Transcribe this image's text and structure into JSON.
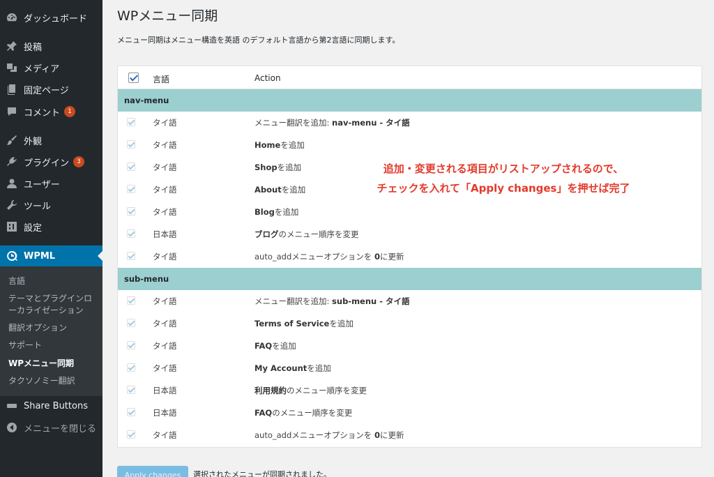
{
  "sidebar": {
    "items": [
      {
        "label": "ダッシュボード",
        "icon": "dashboard-icon"
      },
      {
        "label": "投稿",
        "icon": "pin-icon"
      },
      {
        "label": "メディア",
        "icon": "media-icon"
      },
      {
        "label": "固定ページ",
        "icon": "page-icon"
      },
      {
        "label": "コメント",
        "icon": "comment-icon",
        "badge": "1"
      },
      {
        "label": "外観",
        "icon": "appearance-icon"
      },
      {
        "label": "プラグイン",
        "icon": "plugin-icon",
        "badge": "3"
      },
      {
        "label": "ユーザー",
        "icon": "user-icon"
      },
      {
        "label": "ツール",
        "icon": "wrench-icon"
      },
      {
        "label": "設定",
        "icon": "settings-icon"
      }
    ],
    "wpml": {
      "label": "WPML",
      "icon": "wpml-icon"
    },
    "submenu": [
      "言語",
      "テーマとプラグインロ",
      "ーカライゼーション",
      "翻訳オプション",
      "サポート",
      "WPメニュー同期",
      "タクソノミー翻訳"
    ],
    "share_buttons": "Share Buttons",
    "collapse": "メニューを閉じる"
  },
  "page": {
    "title": "WPメニュー同期",
    "description": "メニュー同期はメニュー構造を英語 のデフォルト言語から第2言語に同期します。"
  },
  "table": {
    "header_lang": "言語",
    "header_action": "Action",
    "groups": [
      {
        "name": "nav-menu",
        "rows": [
          {
            "lang": "タイ語",
            "action_pre": "メニュー翻訳を追加: ",
            "action_bold": "nav-menu - タイ語",
            "action_post": ""
          },
          {
            "lang": "タイ語",
            "action_pre": "",
            "action_bold": "Home",
            "action_post": "を追加"
          },
          {
            "lang": "タイ語",
            "action_pre": "",
            "action_bold": "Shop",
            "action_post": "を追加"
          },
          {
            "lang": "タイ語",
            "action_pre": "",
            "action_bold": "About",
            "action_post": "を追加"
          },
          {
            "lang": "タイ語",
            "action_pre": "",
            "action_bold": "Blog",
            "action_post": "を追加"
          },
          {
            "lang": "日本語",
            "action_pre": "",
            "action_bold": "ブログ",
            "action_post": "のメニュー順序を変更"
          },
          {
            "lang": "タイ語",
            "action_pre": "auto_addメニューオプションを ",
            "action_bold": "0",
            "action_post": "に更新"
          }
        ]
      },
      {
        "name": "sub-menu",
        "rows": [
          {
            "lang": "タイ語",
            "action_pre": "メニュー翻訳を追加: ",
            "action_bold": "sub-menu - タイ語",
            "action_post": ""
          },
          {
            "lang": "タイ語",
            "action_pre": "",
            "action_bold": "Terms of Service",
            "action_post": "を追加"
          },
          {
            "lang": "タイ語",
            "action_pre": "",
            "action_bold": "FAQ",
            "action_post": "を追加"
          },
          {
            "lang": "タイ語",
            "action_pre": "",
            "action_bold": "My Account",
            "action_post": "を追加"
          },
          {
            "lang": "日本語",
            "action_pre": "",
            "action_bold": "利用規約",
            "action_post": "のメニュー順序を変更"
          },
          {
            "lang": "日本語",
            "action_pre": "",
            "action_bold": "FAQ",
            "action_post": "のメニュー順序を変更"
          },
          {
            "lang": "タイ語",
            "action_pre": "auto_addメニューオプションを ",
            "action_bold": "0",
            "action_post": "に更新"
          }
        ]
      }
    ]
  },
  "annotation": {
    "line1": "追加・変更される項目がリストアップされるので、",
    "line2": "チェックを入れて「Apply changes」を押せば完了"
  },
  "footer": {
    "apply_label": "Apply changes",
    "message": "選択されたメニューが同期されました。"
  },
  "colors": {
    "sidebar_bg": "#23282d",
    "submenu_bg": "#32373c",
    "active_bg": "#0073aa",
    "group_bg": "#9ccfcf",
    "annotation": "#e33a2b",
    "badge": "#ca4a1f"
  }
}
